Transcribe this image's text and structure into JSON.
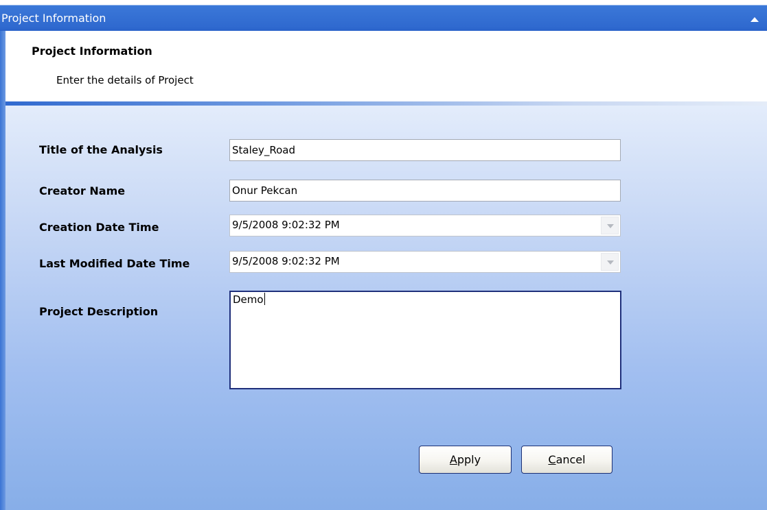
{
  "window": {
    "title": "Project Information"
  },
  "header": {
    "title": "Project Information",
    "subtitle": "Enter the details of Project"
  },
  "form": {
    "title_label": "Title of the Analysis",
    "title_value": "Staley_Road",
    "creator_label": "Creator Name",
    "creator_value": "Onur Pekcan",
    "creation_label": "Creation Date Time",
    "creation_value": "9/5/2008 9:02:32 PM",
    "modified_label": "Last Modified Date Time",
    "modified_value": "9/5/2008 9:02:32 PM",
    "description_label": "Project Description",
    "description_value": "Demo"
  },
  "buttons": {
    "apply_mnemonic": "A",
    "apply_rest": "pply",
    "cancel_mnemonic": "C",
    "cancel_rest": "ancel"
  },
  "icons": {
    "collapse": "chevron-up-icon",
    "dropdown": "chevron-down-icon"
  },
  "colors": {
    "title_bar": "#2f69cf",
    "panel_top": "#e3ecfb",
    "panel_bottom": "#87aee8",
    "button_border": "#1b2f74"
  }
}
